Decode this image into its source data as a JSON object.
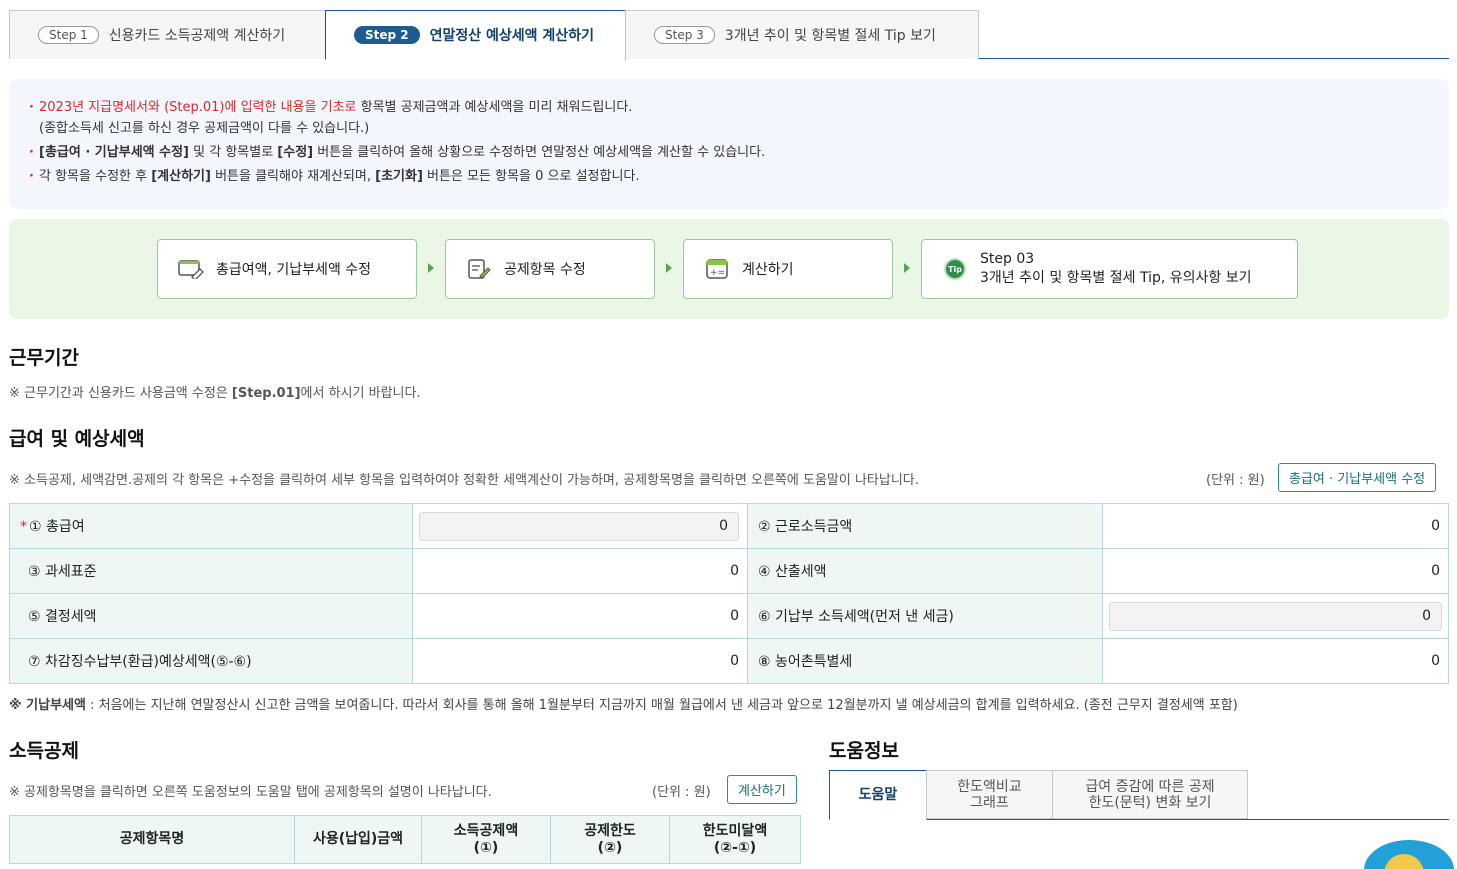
{
  "step_tabs": [
    {
      "badge": "Step 1",
      "label": "신용카드 소득공제액 계산하기"
    },
    {
      "badge": "Step 2",
      "label": "연말정산 예상세액 계산하기"
    },
    {
      "badge": "Step 3",
      "label": "3개년 추이 및 항목별 절세 Tip 보기"
    }
  ],
  "notice": {
    "line1_red": "2023년 지급명세서와 (Step.01)에 입력한 내용을 기초로",
    "line1_rest": " 항목별 공제금액과 예상세액을 미리 채워드립니다.",
    "line1_sub": "(종합소득세 신고를 하신 경우 공제금액이 다를 수 있습니다.)",
    "line2_b1": "[총급여 · 기납부세액 수정]",
    "line2_t1": " 및 각 항목별로 ",
    "line2_b2": "[수정]",
    "line2_t2": " 버튼을 클릭하여 올해 상황으로 수정하면 연말정산 예상세액을 계산할 수 있습니다.",
    "line3_t1": "각 항목을 수정한 후 ",
    "line3_b1": "[계산하기]",
    "line3_t2": " 버튼을 클릭해야 재계산되며, ",
    "line3_b2": "[초기화]",
    "line3_t3": " 버튼은 모든 항목을 0 으로 설정합니다."
  },
  "flow": {
    "step1": "총급여액, 기납부세액 수정",
    "step2": "공제항목 수정",
    "step3": "계산하기",
    "step4_title": "Step 03",
    "step4_sub": "3개년 추이 및 항목별 절세 Tip, 유의사항 보기",
    "tip_text": "Tip"
  },
  "work_period": {
    "title": "근무기간",
    "note_pre": "※ 근무기간과 신용카드 사용금액 수정은 ",
    "note_b": "[Step.01]",
    "note_post": "에서 하시기 바랍니다."
  },
  "salary": {
    "title": "급여 및 예상세액",
    "note": "※ 소득공제, 세액감면.공제의 각 항목은 +수정을 클릭하여 세부 항목을 입력하여야 정확한 세액계산이 가능하며, 공제항목명을 클릭하면 오른쪽에 도움말이 나타납니다.",
    "unit": "(단위 : 원)",
    "edit_button": "총급여 · 기납부세액 수정",
    "rows": [
      {
        "l1": "① 총급여",
        "v1": "0",
        "l2": "② 근로소득금액",
        "v2": "0"
      },
      {
        "l1": "③ 과세표준",
        "v1": "0",
        "l2": "④ 산출세액",
        "v2": "0"
      },
      {
        "l1": "⑤ 결정세액",
        "v1": "0",
        "l2": "⑥ 기납부 소득세액(먼저 낸 세금)",
        "v2": "0"
      },
      {
        "l1": "⑦ 차감징수납부(환급)예상세액(⑤-⑥)",
        "v1": "0",
        "l2": "⑧ 농어촌특별세",
        "v2": "0"
      }
    ],
    "required_mark": "*",
    "footnote_b": "※ 기납부세액",
    "footnote": " : 처음에는 지난해 연말정산시 신고한 금액을 보여줍니다. 따라서 회사를 통해 올해 1월분부터 지금까지 매월 월급에서 낸 세금과 앞으로 12월분까지 낼 예상세금의 합계를 입력하세요. (종전 근무지 결정세액 포함)"
  },
  "deduction": {
    "title": "소득공제",
    "note": "※ 공제항목명을 클릭하면 오른쪽 도움정보의 도움말 탭에 공제항목의 설명이 나타납니다.",
    "unit": "(단위 : 원)",
    "calc_button": "계산하기",
    "headers": {
      "h1": "공제항목명",
      "h2": "사용(납입)금액",
      "h3a": "소득공제액",
      "h3b": "(①)",
      "h4a": "공제한도",
      "h4b": "(②)",
      "h5a": "한도미달액",
      "h5b": "(②-①)"
    }
  },
  "help": {
    "title": "도움정보",
    "tab1": "도움말",
    "tab2a": "한도액비교",
    "tab2b": "그래프",
    "tab3a": "급여 증감에 따른 공제",
    "tab3b": "한도(문턱) 변화 보기"
  },
  "colors": {
    "accent": "#1d5b91",
    "red": "#d62b2b",
    "flow_bg": "#eaf6e6",
    "table_label_bg": "#eef7f6"
  }
}
